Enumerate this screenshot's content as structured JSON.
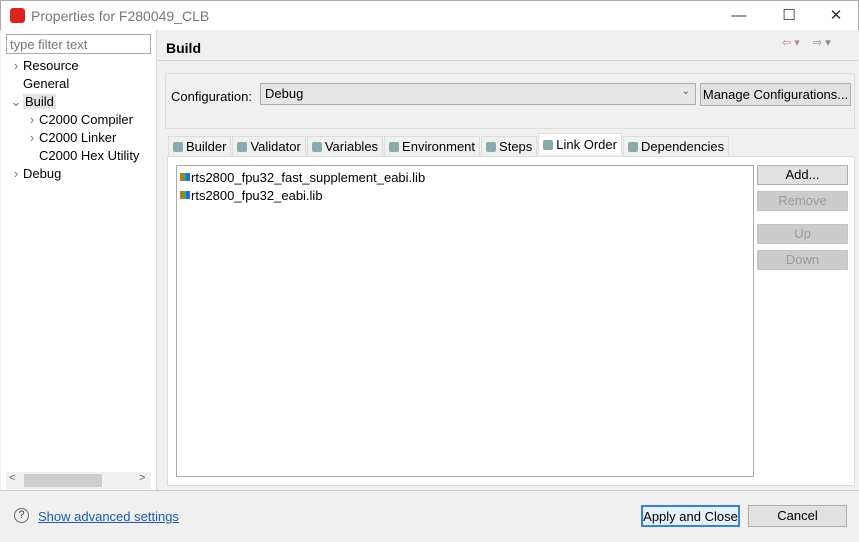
{
  "window": {
    "title": "Properties for F280049_CLB",
    "minimize": "—",
    "maximize": "☐",
    "close": "✕"
  },
  "sidebar": {
    "filter_placeholder": "type filter text",
    "items": [
      {
        "label": "Resource",
        "arrow": ">",
        "level": 0
      },
      {
        "label": "General",
        "arrow": "",
        "level": 0
      },
      {
        "label": "Build",
        "arrow": "v",
        "level": 0,
        "selected": true
      },
      {
        "label": "C2000 Compiler",
        "arrow": ">",
        "level": 1
      },
      {
        "label": "C2000 Linker",
        "arrow": ">",
        "level": 1
      },
      {
        "label": "C2000 Hex Utility",
        "arrow": "",
        "level": 1
      },
      {
        "label": "Debug",
        "arrow": ">",
        "level": 0
      }
    ]
  },
  "main": {
    "title": "Build",
    "nav": {
      "back": "⇦ ▾",
      "forward": "⇨ ▾"
    },
    "configuration": {
      "label": "Configuration:",
      "value": "Debug",
      "manage_button": "Manage Configurations..."
    },
    "tabs": [
      {
        "label": "Builder"
      },
      {
        "label": "Validator"
      },
      {
        "label": "Variables"
      },
      {
        "label": "Environment"
      },
      {
        "label": "Steps"
      },
      {
        "label": "Link Order",
        "active": true
      },
      {
        "label": "Dependencies"
      }
    ],
    "link_order": [
      "rts2800_fpu32_fast_supplement_eabi.lib",
      "rts2800_fpu32_eabi.lib"
    ],
    "buttons": {
      "add": "Add...",
      "remove": "Remove",
      "up": "Up",
      "down": "Down"
    }
  },
  "footer": {
    "help": "?",
    "advanced_link": "Show advanced settings",
    "apply_close": "Apply and Close",
    "cancel": "Cancel"
  }
}
